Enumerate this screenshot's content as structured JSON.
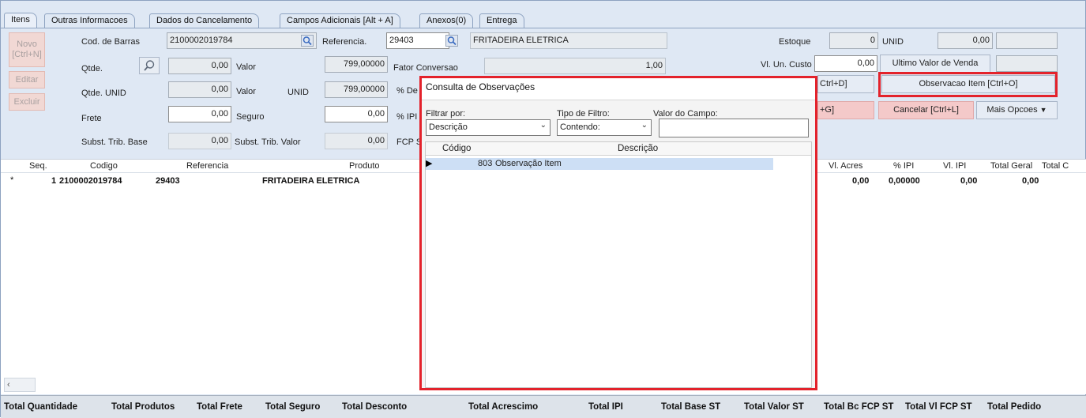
{
  "tabs": [
    "Itens",
    "Outras Informacoes",
    "Dados do Cancelamento",
    "Campos Adicionais [Alt + A]",
    "Anexos(0)",
    "Entrega"
  ],
  "side_buttons": {
    "novo": "Novo\n[Ctrl+N]",
    "editar": "Editar",
    "excluir": "Excluir"
  },
  "form": {
    "cod_barras_label": "Cod. de Barras",
    "cod_barras_value": "2100002019784",
    "referencia_label": "Referencia.",
    "referencia_value": "29403",
    "produto_nome": "FRITADEIRA ELETRICA",
    "estoque_label": "Estoque",
    "estoque_value": "0",
    "estoque_unid": "UNID",
    "estoque_extra": "0,00",
    "qtde_label": "Qtde.",
    "qtde_value": "0,00",
    "valor_label": "Valor",
    "valor_value": "799,00000",
    "fator_label": "Fator Conversao",
    "fator_value": "1,00",
    "vl_un_custo_label": "Vl. Un. Custo",
    "vl_un_custo_value": "0,00",
    "ultimo_valor_label": "Ultimo Valor de Venda",
    "qtde_unid_label": "Qtde. UNID",
    "qtde_unid_value": "0,00",
    "valor2_label": "Valor",
    "unid_label": "UNID",
    "valor2_value": "799,00000",
    "perc_de_label": "% De",
    "frete_label": "Frete",
    "frete_value": "0,00",
    "seguro_label": "Seguro",
    "seguro_value": "0,00",
    "perc_ipi_label": "% IPI",
    "subst_base_label": "Subst. Trib. Base",
    "subst_base_value": "0,00",
    "subst_valor_label": "Subst. Trib. Valor",
    "subst_valor_value": "0,00",
    "fcp_label": "FCP S"
  },
  "action_buttons": {
    "ctrl_d": "Ctrl+D]",
    "observacao": "Observacao Item [Ctrl+O]",
    "ctrl_g": "+G]",
    "cancelar": "Cancelar [Ctrl+L]",
    "mais_opcoes": "Mais Opcoes"
  },
  "grid": {
    "columns_left": [
      "Seq.",
      "Codigo",
      "Referencia",
      "Produto"
    ],
    "columns_right": [
      "Vl. Acres",
      "% IPI",
      "Vl. IPI",
      "Total Geral",
      "Total C"
    ],
    "row": {
      "marker": "*",
      "seq": "1",
      "codigo": "2100002019784",
      "referencia": "29403",
      "produto": "FRITADEIRA ELETRICA",
      "vl_acres": "0,00",
      "perc_ipi": "0,00000",
      "vl_ipi": "0,00",
      "total_geral": "0,00"
    }
  },
  "totals": [
    "Total Quantidade",
    "Total Produtos",
    "Total Frete",
    "Total Seguro",
    "Total Desconto",
    "Total Acrescimo",
    "Total IPI",
    "Total Base ST",
    "Total Valor ST",
    "Total Bc FCP ST",
    "Total Vl FCP ST",
    "Total Pedido"
  ],
  "dialog": {
    "title": "Consulta de Observações",
    "filtrar_label": "Filtrar por:",
    "filtrar_value": "Descrição",
    "tipo_label": "Tipo de Filtro:",
    "tipo_value": "Contendo:",
    "valor_label": "Valor do Campo:",
    "valor_value": "",
    "col_codigo": "Código",
    "col_descricao": "Descrição",
    "row_codigo": "803",
    "row_descricao": "Observação Item"
  },
  "colors": {
    "highlight_border": "#e3222b",
    "window_bg": "#dfe8f4",
    "disabled_button": "#f1d8d4",
    "selected_row": "#cddff5"
  }
}
